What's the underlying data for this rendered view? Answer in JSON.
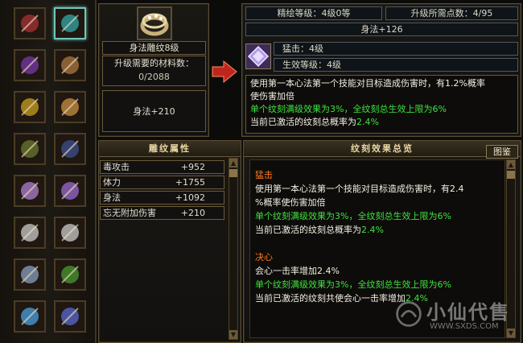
{
  "equipment_slots": [
    {
      "icon": "sword-icon",
      "selected": false
    },
    {
      "icon": "ring-icon",
      "selected": true
    },
    {
      "icon": "armor-icon",
      "selected": false
    },
    {
      "icon": "bracelet-icon",
      "selected": false
    },
    {
      "icon": "boot-icon",
      "selected": false
    },
    {
      "icon": "wrist-guard-icon",
      "selected": false
    },
    {
      "icon": "belt-icon",
      "selected": false
    },
    {
      "icon": "boots-icon",
      "selected": false
    },
    {
      "icon": "hidden-weapon-icon",
      "selected": false
    },
    {
      "icon": "dagger-icon",
      "selected": false
    },
    {
      "icon": "bead-chain-icon",
      "selected": false
    },
    {
      "icon": "bead-chain-2-icon",
      "selected": false
    },
    {
      "icon": "glove-icon",
      "selected": false
    },
    {
      "icon": "amulet-icon",
      "selected": false
    },
    {
      "icon": "spear-icon",
      "selected": false
    },
    {
      "icon": "ornament-icon",
      "selected": false
    }
  ],
  "engrave": {
    "name": "身法雕纹8级",
    "material_label": "升级需要的材料数：",
    "material_count": "0/2088",
    "stat": "身法+210"
  },
  "top_right": {
    "refine_level": "精绘等级：4级0等",
    "upgrade_points": "升级所需点数：4/95",
    "bonus": "身法+126",
    "effect_name": "猛击：4级",
    "effect_level": "生效等级：4级",
    "desc_line1": "使用第一本心法第一个技能对目标造成伤害时，有1.2%概率",
    "desc_line2": "使伤害加倍",
    "desc_green1": "单个纹刻满级效果为3%，全纹刻总生效上限为6%",
    "desc_active_prefix": "当前已激活的纹刻总概率为",
    "desc_active_value": "2.4%"
  },
  "attr_panel": {
    "title": "雕纹属性",
    "rows": [
      {
        "name": "毒攻击",
        "value": "+952"
      },
      {
        "name": "体力",
        "value": "+1755"
      },
      {
        "name": "身法",
        "value": "+1092"
      },
      {
        "name": "忘无附加伤害",
        "value": "+210"
      }
    ]
  },
  "summary_panel": {
    "title": "纹刻效果总览",
    "button": "图鉴",
    "sections": [
      {
        "title": "猛击",
        "line1": "使用第一本心法第一个技能对目标造成伤害时，有2.4",
        "line2": "%概率使伤害加倍",
        "green": "单个纹刻满级效果为3%，全纹刻总生效上限为6%",
        "active_prefix": "当前已激活的纹刻总概率为",
        "active_value": "2.4%"
      },
      {
        "title": "决心",
        "line1": "会心一击率增加2.4%",
        "green": "单个纹刻满级效果为3%，全纹刻总生效上限为6%",
        "active_prefix": "当前已激活的纹刻共使会心一击率增加",
        "active_value": "2.4%"
      }
    ]
  },
  "watermark": {
    "text": "小仙代售",
    "url": "WWW.SXDS.COM"
  },
  "colors": {
    "green": "#3ee23e",
    "orange": "#ff7a1a",
    "gold_border": "#6b5a38"
  }
}
